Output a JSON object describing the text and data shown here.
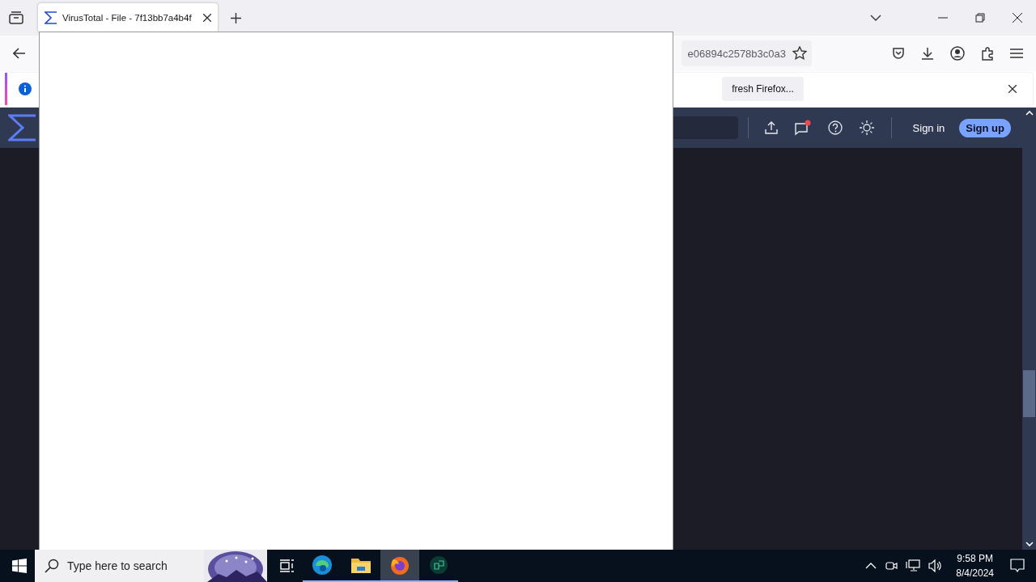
{
  "tabs": [
    {
      "title": "VirusTotal - File - 7f13bb7a4b4f",
      "selected": true
    }
  ],
  "address_bar": {
    "url": "e06894c2578b3c0a3"
  },
  "notification_bar": {
    "button": "fresh Firefox..."
  },
  "site_header": {
    "sign_in": "Sign in",
    "sign_up": "Sign up",
    "has_notification": true
  },
  "taskbar": {
    "search_placeholder": "Type here to search",
    "apps": [
      {
        "kind": "edge",
        "selected": false
      },
      {
        "kind": "explorer",
        "selected": false
      },
      {
        "kind": "firefox",
        "selected": true
      },
      {
        "kind": "other",
        "selected": false
      }
    ],
    "time": "9:58 PM",
    "date": "8/4/2024"
  }
}
